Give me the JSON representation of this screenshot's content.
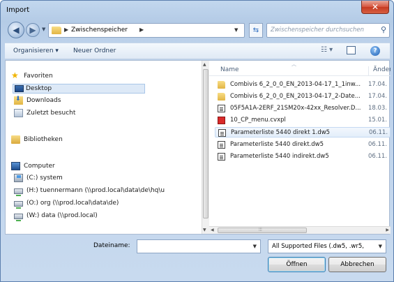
{
  "window": {
    "title": "Import",
    "close_glyph": "✕"
  },
  "nav": {
    "back_glyph": "◀",
    "forward_glyph": "▶",
    "address_crumb": "Zwischenspeicher",
    "search_placeholder": "Zwischenspeicher durchsuchen"
  },
  "toolbar": {
    "organize_label": "Organisieren ▾",
    "new_folder_label": "Neuer Ordner",
    "help_glyph": "?"
  },
  "sidebar": {
    "items": [
      {
        "label": "Favoriten",
        "icon": "star-icon"
      },
      {
        "label": "Desktop",
        "icon": "desktop-icon",
        "selected": true
      },
      {
        "label": "Downloads",
        "icon": "downloads-icon"
      },
      {
        "label": "Zuletzt besucht",
        "icon": "recent-places-icon"
      },
      {
        "label": "Bibliotheken",
        "icon": "libraries-icon"
      },
      {
        "label": "Computer",
        "icon": "computer-icon"
      },
      {
        "label": "(C:) system",
        "icon": "local-drive-icon"
      },
      {
        "label": "(H:) tuennermann (\\\\prod.local\\data\\de\\hq\\u",
        "icon": "network-drive-icon"
      },
      {
        "label": "(O:) org (\\\\prod.local\\data\\de)",
        "icon": "network-drive-icon"
      },
      {
        "label": "(W:) data (\\\\prod.local)",
        "icon": "network-drive-icon"
      }
    ]
  },
  "files": {
    "columns": {
      "name": "Name",
      "date": "Änder"
    },
    "rows": [
      {
        "name": "Combivis 6_2_0_0_EN_2013-04-17_1_1inw...",
        "date": "17.04.",
        "icon": "folder-icon"
      },
      {
        "name": "Combivis 6_2_0_0_EN_2013-04-17_2-Date...",
        "date": "17.04.",
        "icon": "folder-icon"
      },
      {
        "name": "05F5A1A-2ERF_21SM20x-42xx_Resolver.D...",
        "date": "18.03.",
        "icon": "document-icon"
      },
      {
        "name": "10_CP_menu.cvxpl",
        "date": "15.01.",
        "icon": "cvxpl-file-icon"
      },
      {
        "name": "Parameterliste 5440 direkt 1.dw5",
        "date": "06.11.",
        "icon": "document-icon",
        "highlighted": true
      },
      {
        "name": "Parameterliste 5440 direkt.dw5",
        "date": "06.11.",
        "icon": "document-icon"
      },
      {
        "name": "Parameterliste 5440 indirekt.dw5",
        "date": "06.11.",
        "icon": "document-icon"
      }
    ]
  },
  "footer": {
    "filename_label": "Dateiname:",
    "filename_value": "",
    "filter_value": "All Supported Files (.dw5, .wr5,",
    "open_label": "Öffnen",
    "cancel_label": "Abbrechen"
  }
}
